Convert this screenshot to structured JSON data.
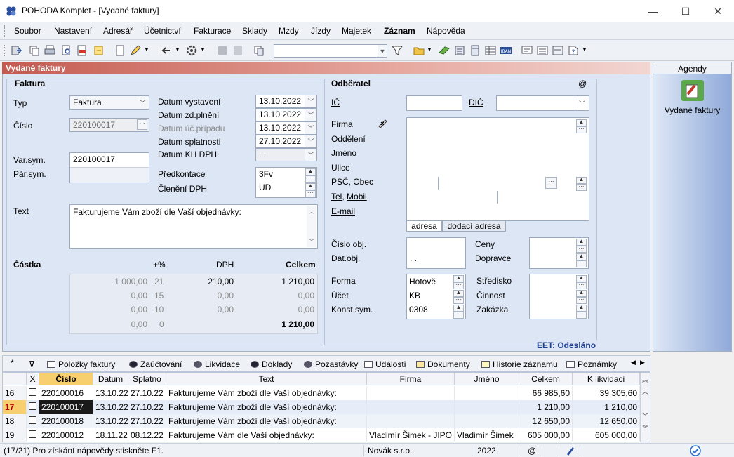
{
  "window": {
    "title": "POHODA Komplet - [Vydané faktury]",
    "minimize": "—",
    "maximize": "☐",
    "close": "✕"
  },
  "menu": [
    "Soubor",
    "Nastavení",
    "Adresář",
    "Účetnictví",
    "Fakturace",
    "Sklady",
    "Mzdy",
    "Jízdy",
    "Majetek",
    "Záznam",
    "Nápověda"
  ],
  "panel_title": "Vydané faktury",
  "faktura": {
    "section": "Faktura",
    "typ_label": "Typ",
    "typ_value": "Faktura",
    "cislo_label": "Číslo",
    "cislo_value": "220100017",
    "varsym_label": "Var.sym.",
    "varsym_value": "220100017",
    "parsym_label": "Pár.sym.",
    "text_label": "Text",
    "text_value": "Fakturujeme Vám zboží dle Vaší objednávky:",
    "datum_vystaveni_label": "Datum vystavení",
    "datum_vystaveni": "13.10.2022",
    "datum_zd_label": "Datum zd.plnění",
    "datum_zd": "13.10.2022",
    "datum_uc_label": "Datum úč.případu",
    "datum_uc": "13.10.2022",
    "datum_splat_label": "Datum splatnosti",
    "datum_splat": "27.10.2022",
    "datum_kh_label": "Datum KH DPH",
    "datum_kh": " .  .",
    "predkontace_label": "Předkontace",
    "predkontace": "3Fv",
    "cleneni_label": "Členění DPH",
    "cleneni": "UD"
  },
  "castka": {
    "label": "Částka",
    "h_pct": "+%",
    "h_dph": "DPH",
    "h_celkem": "Celkem",
    "rows": [
      {
        "base": "1 000,00",
        "pct": "21",
        "dph": "210,00",
        "celkem": "1 210,00"
      },
      {
        "base": "0,00",
        "pct": "15",
        "dph": "0,00",
        "celkem": "0,00"
      },
      {
        "base": "0,00",
        "pct": "10",
        "dph": "0,00",
        "celkem": "0,00"
      },
      {
        "base": "0,00",
        "pct": "0",
        "dph": "",
        "celkem": "1 210,00"
      }
    ]
  },
  "odberatel": {
    "section": "Odběratel",
    "at": "@",
    "ic": "IČ",
    "dic": "DIČ",
    "firma": "Firma",
    "oddeleni": "Oddělení",
    "jmeno": "Jméno",
    "ulice": "Ulice",
    "psc": "PSČ, Obec",
    "tel": "Tel",
    "comma": ",",
    "mobil": "Mobil",
    "email": "E-mail",
    "tab_adresa": "adresa",
    "tab_dodaci": "dodací adresa",
    "cislo_obj": "Číslo obj.",
    "dat_obj": "Dat.obj.",
    "dat_obj_value": " .  .",
    "ceny": "Ceny",
    "dopravce": "Dopravce",
    "forma": "Forma",
    "forma_value": "Hotově",
    "ucet": "Účet",
    "ucet_value": "KB",
    "konst": "Konst.sym.",
    "konst_value": "0308",
    "stredisko": "Středisko",
    "cinnost": "Činnost",
    "zakazka": "Zakázka",
    "eet": "EET: Odesláno"
  },
  "agendy": {
    "header": "Agendy",
    "item": "Vydané faktury"
  },
  "tabs": [
    "Položky faktury",
    "Zaúčtování",
    "Likvidace",
    "Doklady",
    "Pozastávky",
    "Události",
    "Dokumenty",
    "Historie záznamu",
    "Poznámky"
  ],
  "tabs_star": "*",
  "grid": {
    "headers": [
      "",
      "X",
      "Číslo",
      "Datum",
      "Splatno",
      "Text",
      "Firma",
      "Jméno",
      "Celkem",
      "K likvidaci"
    ],
    "rows": [
      {
        "n": "16",
        "cislo": "220100016",
        "datum": "13.10.22",
        "splatno": "27.10.22",
        "text": "Fakturujeme Vám zboží dle Vaší objednávky:",
        "firma": "",
        "jmeno": "",
        "celkem": "66 985,60",
        "klik": "39 305,60"
      },
      {
        "n": "17",
        "cislo": "220100017",
        "datum": "13.10.22",
        "splatno": "27.10.22",
        "text": "Fakturujeme Vám zboží dle Vaší objednávky:",
        "firma": "",
        "jmeno": "",
        "celkem": "1 210,00",
        "klik": "1 210,00"
      },
      {
        "n": "18",
        "cislo": "220100018",
        "datum": "13.10.22",
        "splatno": "27.10.22",
        "text": "Fakturujeme Vám zboží dle Vaší objednávky:",
        "firma": "",
        "jmeno": "",
        "celkem": "12 650,00",
        "klik": "12 650,00"
      },
      {
        "n": "19",
        "cislo": "220100012",
        "datum": "18.11.22",
        "splatno": "08.12.22",
        "text": "Fakturujeme Vám dle Vaší objednávky:",
        "firma": "Vladimír Šimek - JIPO",
        "jmeno": "Vladimír Šimek",
        "celkem": "605 000,00",
        "klik": "605 000,00"
      }
    ]
  },
  "status": {
    "hint": "(17/21) Pro získání nápovědy stiskněte F1.",
    "company": "Novák s.r.o.",
    "year": "2022",
    "at": "@"
  }
}
